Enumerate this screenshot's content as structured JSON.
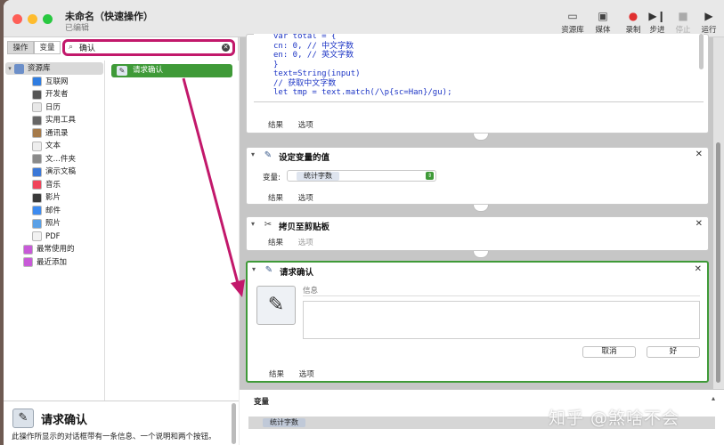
{
  "window": {
    "title": "未命名（快速操作）",
    "subtitle": "已编辑"
  },
  "toolbar": [
    {
      "label": "资源库",
      "icon": "library-icon",
      "glyph": "▭",
      "color": "#444",
      "dim": false
    },
    {
      "label": "媒体",
      "icon": "media-icon",
      "glyph": "▣",
      "color": "#444",
      "dim": false
    },
    {
      "label": "录制",
      "icon": "record-icon",
      "glyph": "●",
      "color": "#e03030",
      "dim": false
    },
    {
      "label": "步进",
      "icon": "step-icon",
      "glyph": "▶❙",
      "color": "#333",
      "dim": false
    },
    {
      "label": "停止",
      "icon": "stop-icon",
      "glyph": "■",
      "color": "#aaaaaa",
      "dim": true
    },
    {
      "label": "运行",
      "icon": "run-icon",
      "glyph": "▶",
      "color": "#333",
      "dim": false
    }
  ],
  "sidebar": {
    "tabs": [
      "操作",
      "变量"
    ],
    "search_value": "确认",
    "library_root": "资源库",
    "categories": [
      {
        "label": "互联网",
        "icon": "globe-icon",
        "color": "#2f7de1"
      },
      {
        "label": "开发者",
        "icon": "tools-icon",
        "color": "#555555"
      },
      {
        "label": "日历",
        "icon": "calendar-icon",
        "color": "#e8e8e8"
      },
      {
        "label": "实用工具",
        "icon": "utilities-icon",
        "color": "#666666"
      },
      {
        "label": "通讯录",
        "icon": "contacts-icon",
        "color": "#a57a4a"
      },
      {
        "label": "文本",
        "icon": "text-icon",
        "color": "#eeeeee"
      },
      {
        "label": "文…件夹",
        "icon": "folder-icon",
        "color": "#8a8a8a"
      },
      {
        "label": "演示文稿",
        "icon": "presentation-icon",
        "color": "#3b78d8"
      },
      {
        "label": "音乐",
        "icon": "music-icon",
        "color": "#f0445a"
      },
      {
        "label": "影片",
        "icon": "movie-icon",
        "color": "#3a3a3a"
      },
      {
        "label": "邮件",
        "icon": "mail-icon",
        "color": "#3d8bf0"
      },
      {
        "label": "照片",
        "icon": "photos-icon",
        "color": "#5aa0e6"
      },
      {
        "label": "PDF",
        "icon": "pdf-icon",
        "color": "#f2f2f2"
      }
    ],
    "special": [
      {
        "label": "最常使用的",
        "icon": "most-used-icon",
        "color": "#c85ad8"
      },
      {
        "label": "最近添加",
        "icon": "recently-added-icon",
        "color": "#c85ad8"
      }
    ],
    "result_action": "请求确认"
  },
  "description": {
    "title": "请求确认",
    "text": "此操作所显示的对话框带有一条信息、一个说明和两个按钮。"
  },
  "workflow": {
    "code_lines": [
      "var total = {",
      "cn: 0, // 中文字数",
      "en: 0, // 英文字数",
      "}",
      "text=String(input)",
      "// 获取中文字数",
      "let tmp = text.match(/\\p{sc=Han}/gu);"
    ],
    "cards": [
      {
        "title": "设定变量的值",
        "variable_label": "变量:",
        "variable_value": "统计字数"
      },
      {
        "title": "拷贝至剪贴板"
      },
      {
        "title": "请求确认",
        "message_placeholder": "信息",
        "cancel_label": "取消",
        "ok_label": "好"
      }
    ],
    "footer": {
      "results": "结果",
      "options": "选项"
    }
  },
  "variables_pane": {
    "title": "变量",
    "items": [
      "统计字数"
    ]
  },
  "watermark": "知乎 @煞啥不会",
  "colors": {
    "accent_green": "#3f9a38",
    "highlight_magenta": "#c2186b"
  }
}
